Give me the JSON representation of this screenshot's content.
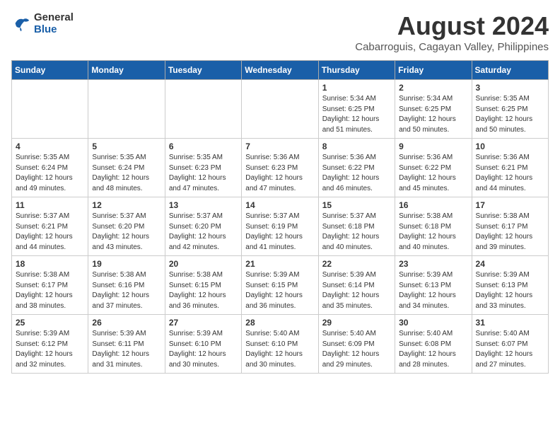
{
  "logo": {
    "line1": "General",
    "line2": "Blue"
  },
  "title": "August 2024",
  "subtitle": "Cabarroguis, Cagayan Valley, Philippines",
  "headers": [
    "Sunday",
    "Monday",
    "Tuesday",
    "Wednesday",
    "Thursday",
    "Friday",
    "Saturday"
  ],
  "weeks": [
    [
      {
        "day": "",
        "info": ""
      },
      {
        "day": "",
        "info": ""
      },
      {
        "day": "",
        "info": ""
      },
      {
        "day": "",
        "info": ""
      },
      {
        "day": "1",
        "info": "Sunrise: 5:34 AM\nSunset: 6:25 PM\nDaylight: 12 hours\nand 51 minutes."
      },
      {
        "day": "2",
        "info": "Sunrise: 5:34 AM\nSunset: 6:25 PM\nDaylight: 12 hours\nand 50 minutes."
      },
      {
        "day": "3",
        "info": "Sunrise: 5:35 AM\nSunset: 6:25 PM\nDaylight: 12 hours\nand 50 minutes."
      }
    ],
    [
      {
        "day": "4",
        "info": "Sunrise: 5:35 AM\nSunset: 6:24 PM\nDaylight: 12 hours\nand 49 minutes."
      },
      {
        "day": "5",
        "info": "Sunrise: 5:35 AM\nSunset: 6:24 PM\nDaylight: 12 hours\nand 48 minutes."
      },
      {
        "day": "6",
        "info": "Sunrise: 5:35 AM\nSunset: 6:23 PM\nDaylight: 12 hours\nand 47 minutes."
      },
      {
        "day": "7",
        "info": "Sunrise: 5:36 AM\nSunset: 6:23 PM\nDaylight: 12 hours\nand 47 minutes."
      },
      {
        "day": "8",
        "info": "Sunrise: 5:36 AM\nSunset: 6:22 PM\nDaylight: 12 hours\nand 46 minutes."
      },
      {
        "day": "9",
        "info": "Sunrise: 5:36 AM\nSunset: 6:22 PM\nDaylight: 12 hours\nand 45 minutes."
      },
      {
        "day": "10",
        "info": "Sunrise: 5:36 AM\nSunset: 6:21 PM\nDaylight: 12 hours\nand 44 minutes."
      }
    ],
    [
      {
        "day": "11",
        "info": "Sunrise: 5:37 AM\nSunset: 6:21 PM\nDaylight: 12 hours\nand 44 minutes."
      },
      {
        "day": "12",
        "info": "Sunrise: 5:37 AM\nSunset: 6:20 PM\nDaylight: 12 hours\nand 43 minutes."
      },
      {
        "day": "13",
        "info": "Sunrise: 5:37 AM\nSunset: 6:20 PM\nDaylight: 12 hours\nand 42 minutes."
      },
      {
        "day": "14",
        "info": "Sunrise: 5:37 AM\nSunset: 6:19 PM\nDaylight: 12 hours\nand 41 minutes."
      },
      {
        "day": "15",
        "info": "Sunrise: 5:37 AM\nSunset: 6:18 PM\nDaylight: 12 hours\nand 40 minutes."
      },
      {
        "day": "16",
        "info": "Sunrise: 5:38 AM\nSunset: 6:18 PM\nDaylight: 12 hours\nand 40 minutes."
      },
      {
        "day": "17",
        "info": "Sunrise: 5:38 AM\nSunset: 6:17 PM\nDaylight: 12 hours\nand 39 minutes."
      }
    ],
    [
      {
        "day": "18",
        "info": "Sunrise: 5:38 AM\nSunset: 6:17 PM\nDaylight: 12 hours\nand 38 minutes."
      },
      {
        "day": "19",
        "info": "Sunrise: 5:38 AM\nSunset: 6:16 PM\nDaylight: 12 hours\nand 37 minutes."
      },
      {
        "day": "20",
        "info": "Sunrise: 5:38 AM\nSunset: 6:15 PM\nDaylight: 12 hours\nand 36 minutes."
      },
      {
        "day": "21",
        "info": "Sunrise: 5:39 AM\nSunset: 6:15 PM\nDaylight: 12 hours\nand 36 minutes."
      },
      {
        "day": "22",
        "info": "Sunrise: 5:39 AM\nSunset: 6:14 PM\nDaylight: 12 hours\nand 35 minutes."
      },
      {
        "day": "23",
        "info": "Sunrise: 5:39 AM\nSunset: 6:13 PM\nDaylight: 12 hours\nand 34 minutes."
      },
      {
        "day": "24",
        "info": "Sunrise: 5:39 AM\nSunset: 6:13 PM\nDaylight: 12 hours\nand 33 minutes."
      }
    ],
    [
      {
        "day": "25",
        "info": "Sunrise: 5:39 AM\nSunset: 6:12 PM\nDaylight: 12 hours\nand 32 minutes."
      },
      {
        "day": "26",
        "info": "Sunrise: 5:39 AM\nSunset: 6:11 PM\nDaylight: 12 hours\nand 31 minutes."
      },
      {
        "day": "27",
        "info": "Sunrise: 5:39 AM\nSunset: 6:10 PM\nDaylight: 12 hours\nand 30 minutes."
      },
      {
        "day": "28",
        "info": "Sunrise: 5:40 AM\nSunset: 6:10 PM\nDaylight: 12 hours\nand 30 minutes."
      },
      {
        "day": "29",
        "info": "Sunrise: 5:40 AM\nSunset: 6:09 PM\nDaylight: 12 hours\nand 29 minutes."
      },
      {
        "day": "30",
        "info": "Sunrise: 5:40 AM\nSunset: 6:08 PM\nDaylight: 12 hours\nand 28 minutes."
      },
      {
        "day": "31",
        "info": "Sunrise: 5:40 AM\nSunset: 6:07 PM\nDaylight: 12 hours\nand 27 minutes."
      }
    ]
  ]
}
